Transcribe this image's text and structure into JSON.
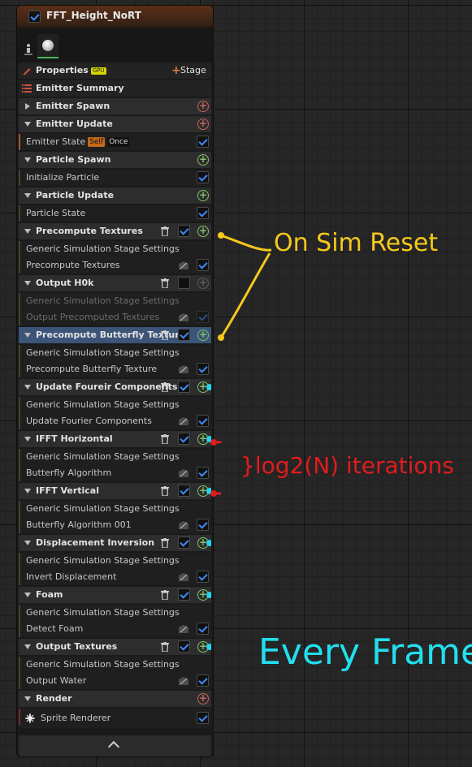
{
  "node": {
    "title": "FFT_Height_NoRT"
  },
  "toolbar": {
    "properties": "Properties",
    "gpu_badge": "GPU",
    "stage": "Stage",
    "emitter_summary": "Emitter Summary"
  },
  "rows": {
    "emitter_spawn": "Emitter Spawn",
    "emitter_update": "Emitter Update",
    "emitter_state": "Emitter State",
    "badge_self": "Self",
    "badge_once": "Once",
    "particle_spawn": "Particle Spawn",
    "initialize_particle": "Initialize Particle",
    "particle_update": "Particle Update",
    "particle_state": "Particle State",
    "precompute_textures": "Precompute Textures",
    "gss1": "Generic Simulation Stage Settings",
    "precompute_textures_item": "Precompute Textures",
    "output_h0k": "Output H0k",
    "gss2": "Generic Simulation Stage Settings",
    "output_precomputed": "Output Precomputed Textures",
    "precompute_butterfly": "Precompute Butterfly Texture",
    "gss3": "Generic Simulation Stage Settings",
    "precompute_butterfly_item": "Precompute Butterfly Texture",
    "update_foureir": "Update Foureir Components",
    "gss4": "Generic Simulation Stage Settings",
    "update_fourier_item": "Update Fourier Components",
    "ifft_horizontal": "IFFT Horizontal",
    "gss5": "Generic Simulation Stage Settings",
    "butterfly_algorithm": "Butterfly Algorithm",
    "ifft_vertical": "IFFT Vertical",
    "gss6": "Generic Simulation Stage Settings",
    "butterfly_algorithm_001": "Butterfly Algorithm 001",
    "displacement_inversion": "Displacement Inversion",
    "gss7": "Generic Simulation Stage Settings",
    "invert_displacement": "Invert Displacement",
    "foam": "Foam",
    "gss8": "Generic Simulation Stage Settings",
    "detect_foam": "Detect Foam",
    "output_textures": "Output Textures",
    "gss9": "Generic Simulation Stage Settings",
    "output_water": "Output Water",
    "render": "Render",
    "sprite_renderer": "Sprite Renderer"
  },
  "annotations": {
    "on_sim_reset": "On Sim Reset",
    "log_iterations": "}log2(N) iterations",
    "every_frame": "Every Frame"
  },
  "colors": {
    "yellow": "#f5c81c",
    "red": "#e11c1c",
    "cyan": "#22dfee",
    "enabled_check": "#3d8bff",
    "add_green": "#7ec06a",
    "selected": "#3b5478"
  }
}
